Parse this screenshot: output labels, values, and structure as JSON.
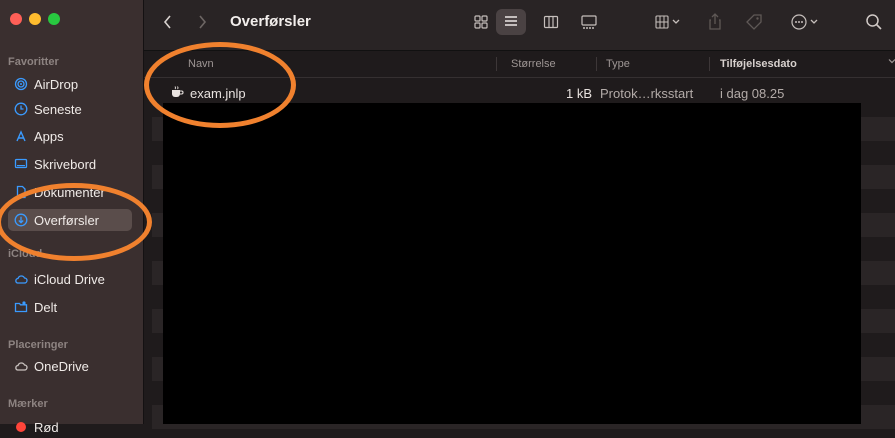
{
  "window": {
    "title": "Overførsler",
    "traffic_colors": [
      "#fe5f57",
      "#febc2e",
      "#28c840"
    ]
  },
  "sidebar": {
    "favorites_label": "Favoritter",
    "icloud_label": "iCloud",
    "locations_label": "Placeringer",
    "tags_label": "Mærker",
    "items": [
      {
        "label": "AirDrop",
        "icon": "airdrop-icon"
      },
      {
        "label": "Seneste",
        "icon": "clock-icon"
      },
      {
        "label": "Apps",
        "icon": "apps-icon"
      },
      {
        "label": "Skrivebord",
        "icon": "desktop-icon"
      },
      {
        "label": "Dokumenter",
        "icon": "document-icon"
      },
      {
        "label": "Overførsler",
        "icon": "download-icon"
      },
      {
        "label": "iCloud Drive",
        "icon": "cloud-icon"
      },
      {
        "label": "Delt",
        "icon": "shared-folder-icon"
      },
      {
        "label": "OneDrive",
        "icon": "cloud-icon"
      },
      {
        "label": "Rød",
        "icon": "red-tag-icon"
      }
    ]
  },
  "columns": {
    "name": "Navn",
    "size": "Størrelse",
    "type": "Type",
    "date": "Tilføjelsesdato"
  },
  "files": [
    {
      "name": "exam.jnlp",
      "size": "1 kB",
      "type": "Protok…rksstart",
      "date": "i dag 08.25"
    }
  ],
  "colors": {
    "accent": "#3a9bff",
    "annotation": "#f0812e",
    "tag_red": "#ff453a"
  }
}
